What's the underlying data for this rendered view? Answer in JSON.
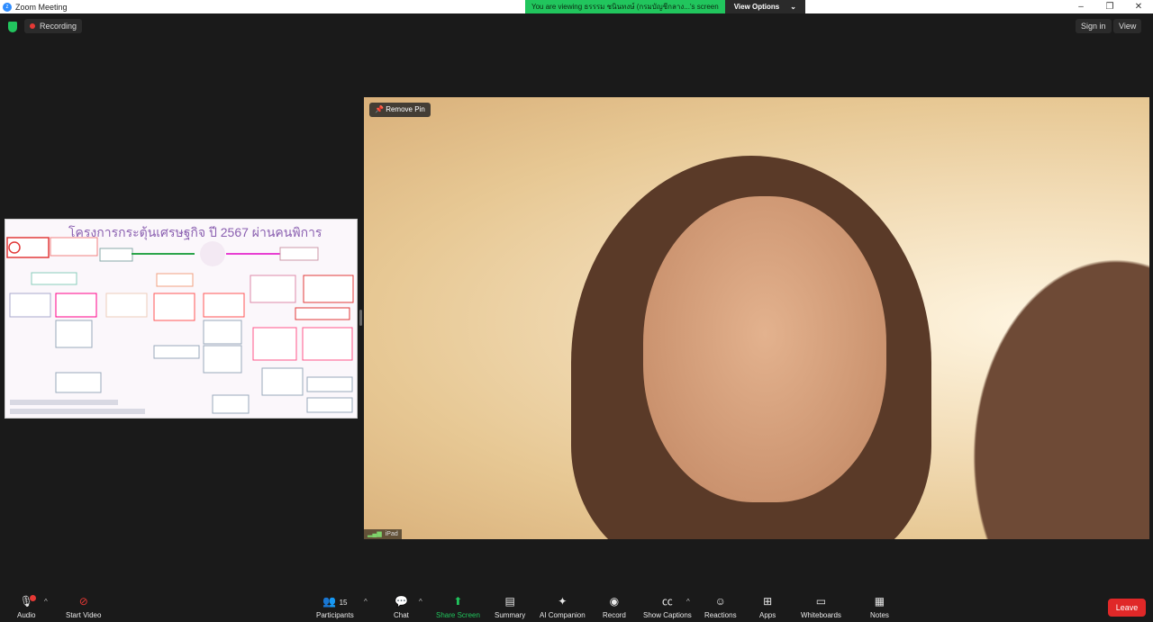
{
  "window": {
    "title": "Zoom Meeting",
    "controls": [
      "–",
      "❐",
      "✕"
    ]
  },
  "share_banner": {
    "message": "You are viewing ธรรรม ชนินทงษ์ (กรมบัญชีกลาง...'s screen",
    "view_options": "View Options",
    "chevron": "⌄"
  },
  "topbar": {
    "recording": "Recording",
    "sign_in": "Sign in",
    "view": "View"
  },
  "shared_content": {
    "title": "โครงการกระตุ้นเศรษฐกิจ ปี 2567 ผ่านคนพิการ"
  },
  "video": {
    "remove_pin": "Remove Pin",
    "device": "iPad"
  },
  "toolbar": {
    "audio": "Audio",
    "start_video": "Start Video",
    "participants": "Participants",
    "participants_count": "15",
    "chat": "Chat",
    "share_screen": "Share Screen",
    "summary": "Summary",
    "ai_companion": "AI Companion",
    "record": "Record",
    "show_captions": "Show Captions",
    "reactions": "Reactions",
    "apps": "Apps",
    "whiteboards": "Whiteboards",
    "notes": "Notes",
    "leave": "Leave"
  },
  "colors": {
    "accent_green": "#21c55d",
    "leave_red": "#e02828",
    "bg": "#1a1a1a"
  }
}
